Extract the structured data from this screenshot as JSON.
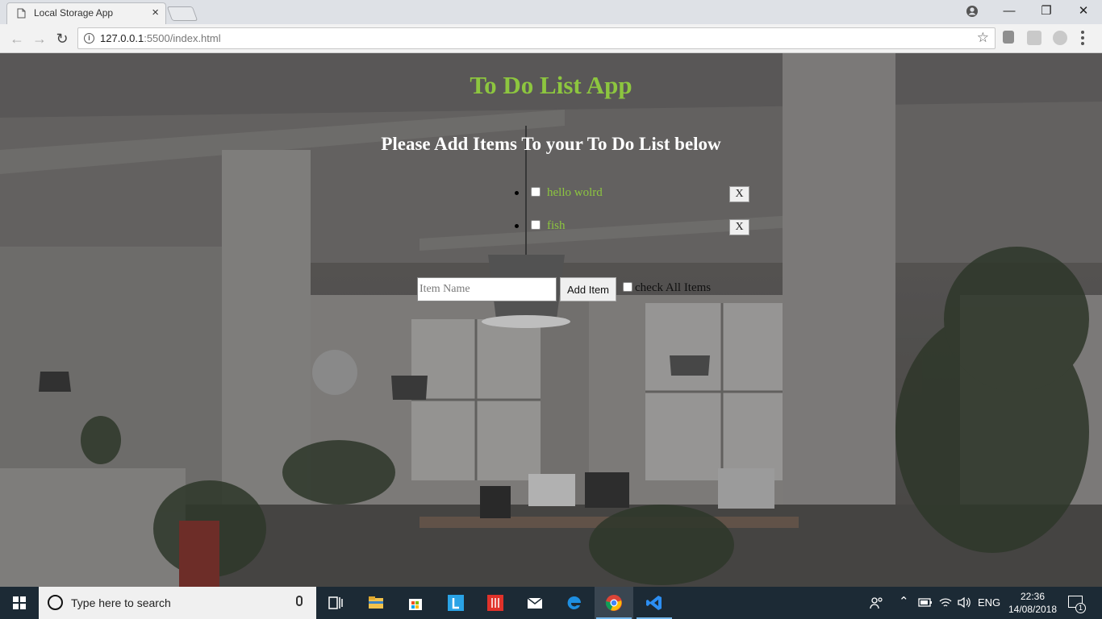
{
  "browser": {
    "tab_title": "Local Storage App",
    "tab_close": "×",
    "url_host": "127.0.0.1",
    "url_path": ":5500/index.html",
    "window_controls": {
      "minimize": "—",
      "restore": "❐",
      "close": "✕"
    }
  },
  "page": {
    "title": "To Do List App",
    "subtitle": "Please Add Items To your To Do List below",
    "items": [
      {
        "label": "hello wolrd",
        "checked": false,
        "delete_label": "X"
      },
      {
        "label": "fish",
        "checked": false,
        "delete_label": "X"
      }
    ],
    "input_placeholder": "Item Name",
    "add_button_label": "Add Item",
    "check_all_label": "check All Items",
    "accent_color": "#8dc63f"
  },
  "taskbar": {
    "search_placeholder": "Type here to search",
    "language": "ENG",
    "time": "22:36",
    "date": "14/08/2018",
    "notification_count": "1"
  }
}
